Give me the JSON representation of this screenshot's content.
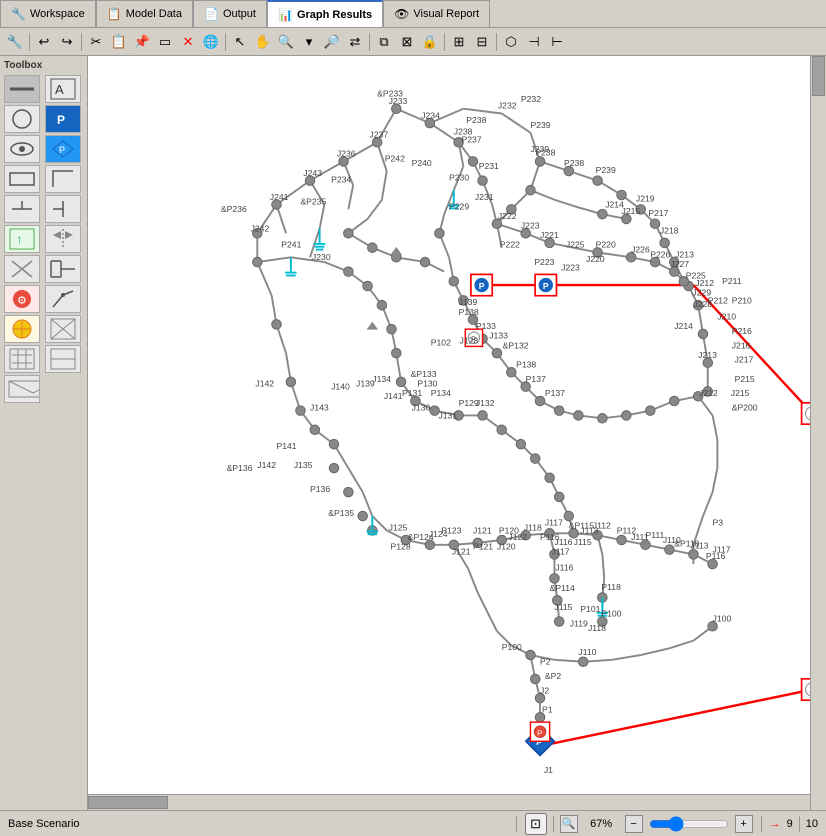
{
  "tabs": [
    {
      "id": "workspace",
      "label": "Workspace",
      "icon": "🔧",
      "active": false
    },
    {
      "id": "model-data",
      "label": "Model Data",
      "icon": "📋",
      "active": false
    },
    {
      "id": "output",
      "label": "Output",
      "icon": "📄",
      "active": false
    },
    {
      "id": "graph-results",
      "label": "Graph Results",
      "icon": "📊",
      "active": true
    },
    {
      "id": "visual-report",
      "label": "Visual Report",
      "icon": "👁",
      "active": false
    }
  ],
  "toolbox": {
    "label": "Toolbox",
    "items": [
      {
        "name": "pipe-tool",
        "icon": "—",
        "color": "#888"
      },
      {
        "name": "text-tool",
        "icon": "A",
        "color": "#333"
      },
      {
        "name": "circle-tool",
        "icon": "○",
        "color": "#888"
      },
      {
        "name": "junction-tool",
        "icon": "P",
        "color": "#1565C0",
        "bg": "#1565C0",
        "fg": "white"
      },
      {
        "name": "eye-tool",
        "icon": "◉",
        "color": "#333"
      },
      {
        "name": "valve-tool",
        "icon": "⬡",
        "color": "#2196F3"
      },
      {
        "name": "rect-tool",
        "icon": "▭",
        "color": "#888"
      },
      {
        "name": "angle-tool",
        "icon": "⌐",
        "color": "#888"
      },
      {
        "name": "clamp-tool",
        "icon": "⊤",
        "color": "#888"
      },
      {
        "name": "split-tool",
        "icon": "⊣",
        "color": "#888"
      },
      {
        "name": "arrow-tool",
        "icon": "↑",
        "color": "#2ecc71",
        "bg": "#2ecc71"
      },
      {
        "name": "mirror-tool",
        "icon": "⊥",
        "color": "#888"
      },
      {
        "name": "cut-tool",
        "icon": "✂",
        "color": "#888"
      },
      {
        "name": "connect-tool",
        "icon": "⊢",
        "color": "#888"
      },
      {
        "name": "pump-tool",
        "icon": "⚙",
        "color": "#e74c3c",
        "bg": "#e74c3c"
      },
      {
        "name": "spray-tool",
        "icon": "💧",
        "color": "#888"
      },
      {
        "name": "circle-y-tool",
        "icon": "⊙",
        "color": "#f1c40f",
        "bg": "#f1c40f"
      },
      {
        "name": "cross-tool",
        "icon": "⊞",
        "color": "#888"
      },
      {
        "name": "grid-tool",
        "icon": "⊟",
        "color": "#888"
      },
      {
        "name": "plug-tool",
        "icon": "⊡",
        "color": "#888"
      },
      {
        "name": "envelope-tool",
        "icon": "✉",
        "color": "#888"
      }
    ]
  },
  "status": {
    "scenario": "Base Scenario",
    "zoom": "67%",
    "arrow_count": "9",
    "counter": "10"
  }
}
